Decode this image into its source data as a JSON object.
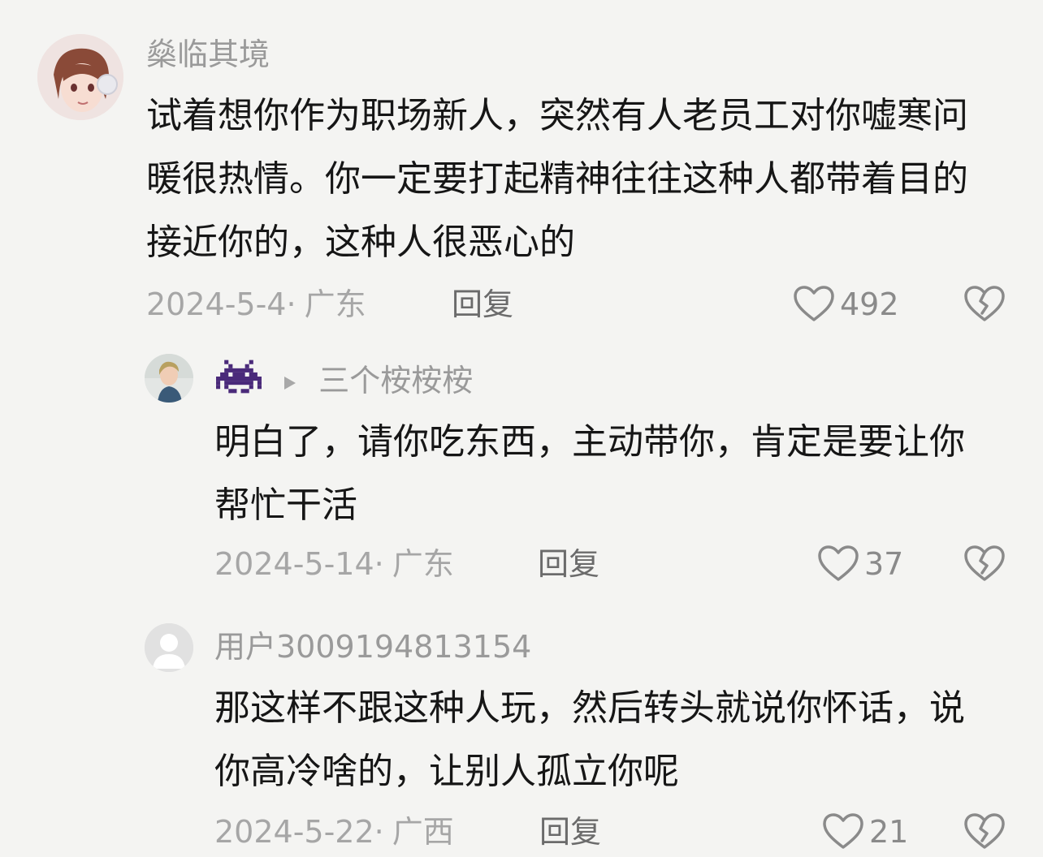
{
  "comments": [
    {
      "username": "燊临其境",
      "text": "试着想你作为职场新人，突然有人老员工对你嘘寒问暖很热情。你一定要打起精神往往这种人都带着目的接近你的，这种人很恶心的",
      "date": "2024-5-4·",
      "location": "广东",
      "reply_label": "回复",
      "likes": "492"
    },
    {
      "username_icon": "space-invader-icon",
      "reply_to": "三个桉桉桉",
      "text": "明白了，请你吃东西，主动带你，肯定是要让你帮忙干活",
      "date": "2024-5-14·",
      "location": "广东",
      "reply_label": "回复",
      "likes": "37"
    },
    {
      "username": "用户3009194813154",
      "text": "那这样不跟这种人玩，然后转头就说你怀话，说你高冷啥的，让别人孤立你呢",
      "date": "2024-5-22·",
      "location": "广西",
      "reply_label": "回复",
      "likes": "21"
    }
  ],
  "colors": {
    "background": "#f4f4f2",
    "text": "#161616",
    "muted": "#9a9a9a",
    "icon": "#8a8a8a"
  }
}
